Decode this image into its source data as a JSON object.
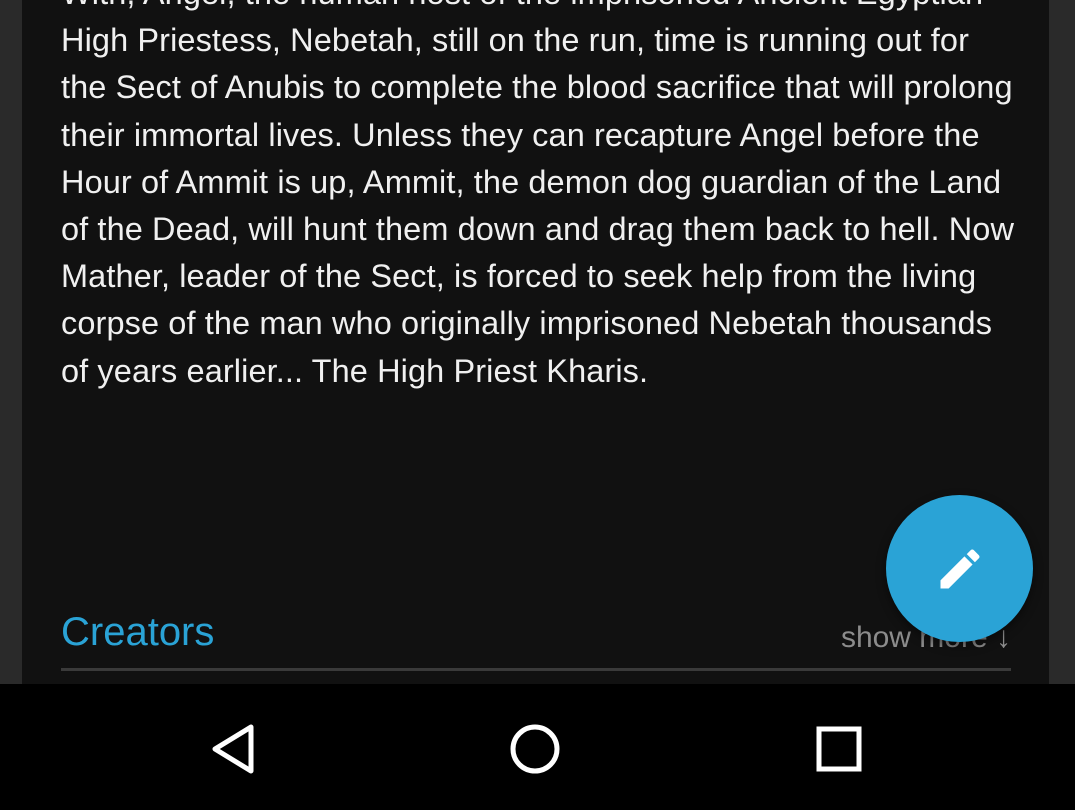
{
  "book": {
    "description": "With, Angel, the human host of the imprisoned Ancient Egyptian High Priestess, Nebetah, still on the run, time is running out for the Sect of Anubis to complete the blood sacrifice that will prolong their immortal lives. Unless they can recapture Angel before the Hour of Ammit is up, Ammit, the demon dog guardian of the Land of the Dead, will hunt them down and drag them back to hell. Now Mather, leader of the Sect, is forced to seek help from the living corpse of the man who originally imprisoned Nebetah thousands of years earlier... The High Priest Kharis."
  },
  "creators_section": {
    "title": "Creators",
    "show_more_label": "show more ↓"
  },
  "fab": {
    "icon": "pencil-edit-icon"
  },
  "nav_bar": {
    "back_icon": "back-triangle-icon",
    "home_icon": "home-circle-icon",
    "recents_icon": "recents-square-icon"
  },
  "colors": {
    "accent": "#2aa3d6",
    "card_background": "#111111",
    "text_primary": "#f0f0f0",
    "text_secondary": "#8c8c8c",
    "nav_background": "#000000"
  }
}
